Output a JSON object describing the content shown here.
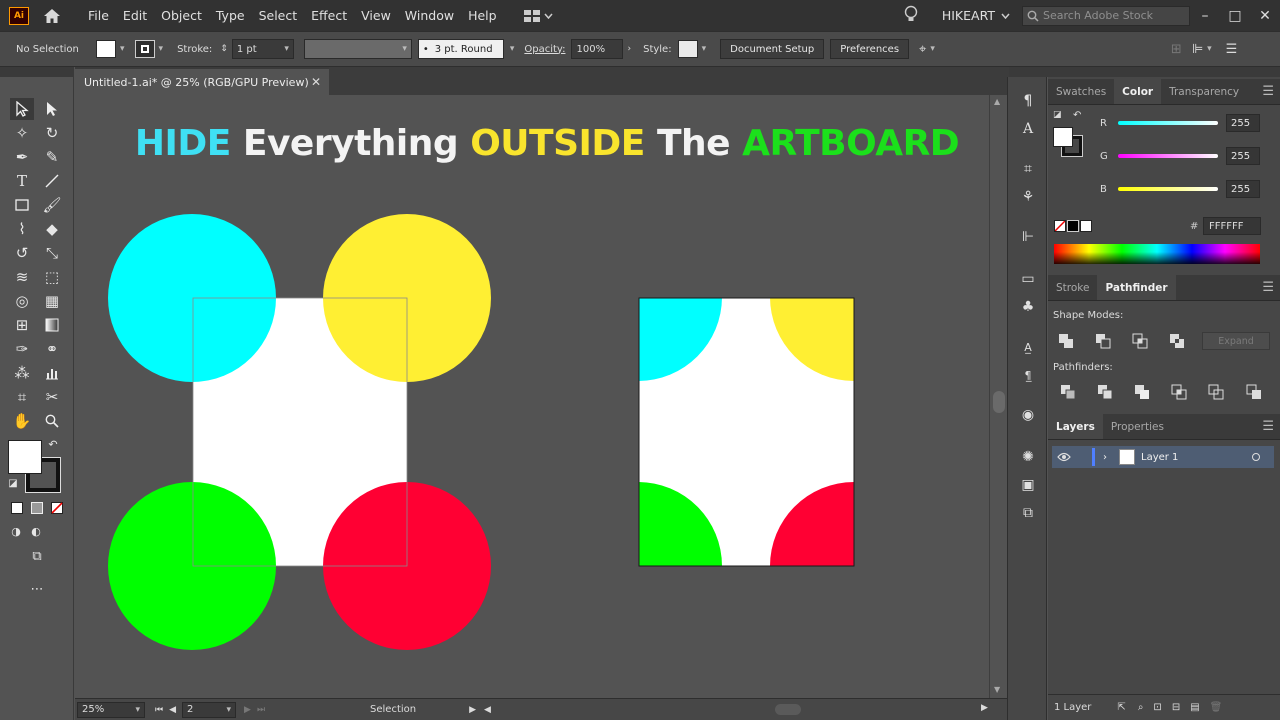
{
  "app": {
    "logo_text": "Ai",
    "menu": [
      "File",
      "Edit",
      "Object",
      "Type",
      "Select",
      "Effect",
      "View",
      "Window",
      "Help"
    ],
    "user": "HIKEART",
    "search_placeholder": "Search Adobe Stock",
    "window_controls": [
      "–",
      "□",
      "✕"
    ]
  },
  "controlbar": {
    "selection_label": "No Selection",
    "stroke_label": "Stroke:",
    "stroke_weight": "1 pt",
    "brush": "3 pt. Round",
    "brush_dot": "•",
    "opacity_label": "Opacity:",
    "opacity_value": "100%",
    "style_label": "Style:",
    "document_setup": "Document Setup",
    "preferences": "Preferences"
  },
  "document": {
    "tab_title": "Untitled-1.ai* @ 25% (RGB/GPU Preview)",
    "close": "✕"
  },
  "canvas": {
    "headline": [
      "HIDE",
      "Everything",
      "OUTSIDE",
      "The",
      "ARTBOARD"
    ],
    "colors": {
      "cyan": "#00ffff",
      "yellow": "#ffef33",
      "green": "#00ff00",
      "red": "#ff0033",
      "artboard": "#ffffff",
      "pasteboard": "#535353"
    }
  },
  "statusbar": {
    "zoom": "25%",
    "artboard_number": "2",
    "tool_name": "Selection"
  },
  "color_panel": {
    "tabs": [
      "Swatches",
      "Color",
      "Transparency"
    ],
    "active_tab": "Color",
    "channels": [
      {
        "label": "R",
        "value": "255",
        "color": "#00e5ff"
      },
      {
        "label": "G",
        "value": "255",
        "color": "#e040e0"
      },
      {
        "label": "B",
        "value": "255",
        "color": "#ffff40"
      }
    ],
    "hex_prefix": "#",
    "hex_value": "FFFFFF"
  },
  "pathfinder_panel": {
    "tabs": [
      "Stroke",
      "Pathfinder"
    ],
    "active_tab": "Pathfinder",
    "shape_modes_label": "Shape Modes:",
    "pathfinders_label": "Pathfinders:",
    "expand_label": "Expand"
  },
  "layers_panel": {
    "tabs": [
      "Layers",
      "Properties"
    ],
    "active_tab": "Layers",
    "layer_name": "Layer 1",
    "footer_count": "1 Layer"
  }
}
